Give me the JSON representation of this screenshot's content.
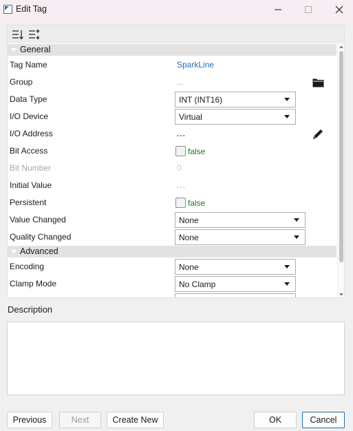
{
  "window": {
    "title": "Edit Tag",
    "icon": "tag-edit-icon"
  },
  "toolbar": {
    "buttons": [
      "sort-categorized-icon",
      "sort-alphabetical-icon"
    ]
  },
  "categories": {
    "general": "General",
    "advanced": "Advanced"
  },
  "properties": {
    "tag_name": {
      "label": "Tag Name",
      "value": "SparkLine"
    },
    "group": {
      "label": "Group",
      "value": "..."
    },
    "data_type": {
      "label": "Data Type",
      "value": "INT (INT16)"
    },
    "io_device": {
      "label": "I/O Device",
      "value": "Virtual"
    },
    "io_address": {
      "label": "I/O Address",
      "value": "..."
    },
    "bit_access": {
      "label": "Bit Access",
      "value": "false"
    },
    "bit_number": {
      "label": "Bit Number",
      "value": "0"
    },
    "initial_value": {
      "label": "Initial Value",
      "value": "..."
    },
    "persistent": {
      "label": "Persistent",
      "value": "false"
    },
    "value_changed": {
      "label": "Value Changed",
      "value": "None"
    },
    "quality_changed": {
      "label": "Quality Changed",
      "value": "None"
    },
    "encoding": {
      "label": "Encoding",
      "value": "None"
    },
    "clamp_mode": {
      "label": "Clamp Mode",
      "value": "No Clamp"
    }
  },
  "description": {
    "label": "Description",
    "value": ""
  },
  "buttons": {
    "previous": "Previous",
    "next": "Next",
    "create_new": "Create New",
    "ok": "OK",
    "cancel": "Cancel"
  },
  "colors": {
    "link": "#1c6fb5",
    "false_text": "#1b7a1b",
    "initial_value_dots": "#d9822b",
    "disabled_text": "#a8a8a8"
  }
}
